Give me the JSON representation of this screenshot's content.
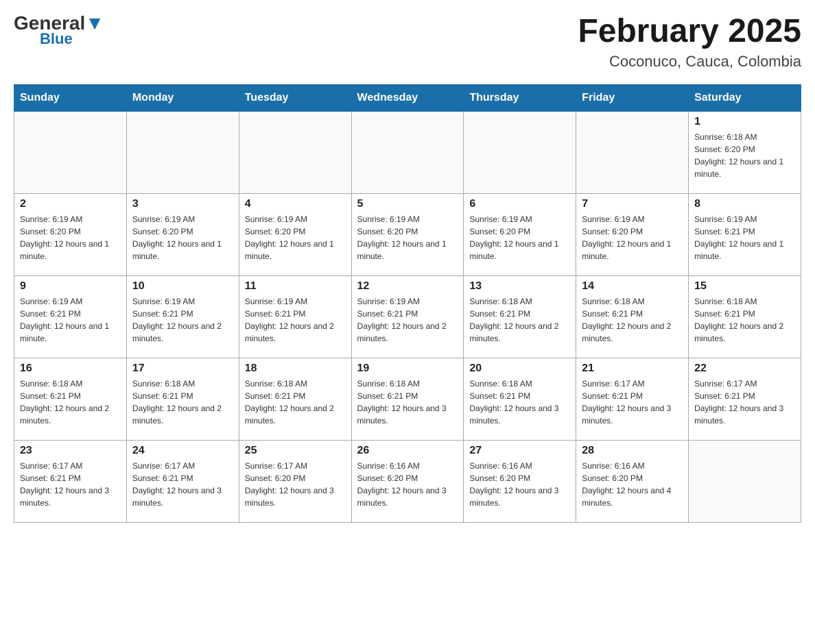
{
  "header": {
    "logo_general": "General",
    "logo_blue": "Blue",
    "month_title": "February 2025",
    "location": "Coconuco, Cauca, Colombia"
  },
  "days_of_week": [
    "Sunday",
    "Monday",
    "Tuesday",
    "Wednesday",
    "Thursday",
    "Friday",
    "Saturday"
  ],
  "weeks": [
    [
      {
        "day": "",
        "info": ""
      },
      {
        "day": "",
        "info": ""
      },
      {
        "day": "",
        "info": ""
      },
      {
        "day": "",
        "info": ""
      },
      {
        "day": "",
        "info": ""
      },
      {
        "day": "",
        "info": ""
      },
      {
        "day": "1",
        "info": "Sunrise: 6:18 AM\nSunset: 6:20 PM\nDaylight: 12 hours and 1 minute."
      }
    ],
    [
      {
        "day": "2",
        "info": "Sunrise: 6:19 AM\nSunset: 6:20 PM\nDaylight: 12 hours and 1 minute."
      },
      {
        "day": "3",
        "info": "Sunrise: 6:19 AM\nSunset: 6:20 PM\nDaylight: 12 hours and 1 minute."
      },
      {
        "day": "4",
        "info": "Sunrise: 6:19 AM\nSunset: 6:20 PM\nDaylight: 12 hours and 1 minute."
      },
      {
        "day": "5",
        "info": "Sunrise: 6:19 AM\nSunset: 6:20 PM\nDaylight: 12 hours and 1 minute."
      },
      {
        "day": "6",
        "info": "Sunrise: 6:19 AM\nSunset: 6:20 PM\nDaylight: 12 hours and 1 minute."
      },
      {
        "day": "7",
        "info": "Sunrise: 6:19 AM\nSunset: 6:20 PM\nDaylight: 12 hours and 1 minute."
      },
      {
        "day": "8",
        "info": "Sunrise: 6:19 AM\nSunset: 6:21 PM\nDaylight: 12 hours and 1 minute."
      }
    ],
    [
      {
        "day": "9",
        "info": "Sunrise: 6:19 AM\nSunset: 6:21 PM\nDaylight: 12 hours and 1 minute."
      },
      {
        "day": "10",
        "info": "Sunrise: 6:19 AM\nSunset: 6:21 PM\nDaylight: 12 hours and 2 minutes."
      },
      {
        "day": "11",
        "info": "Sunrise: 6:19 AM\nSunset: 6:21 PM\nDaylight: 12 hours and 2 minutes."
      },
      {
        "day": "12",
        "info": "Sunrise: 6:19 AM\nSunset: 6:21 PM\nDaylight: 12 hours and 2 minutes."
      },
      {
        "day": "13",
        "info": "Sunrise: 6:18 AM\nSunset: 6:21 PM\nDaylight: 12 hours and 2 minutes."
      },
      {
        "day": "14",
        "info": "Sunrise: 6:18 AM\nSunset: 6:21 PM\nDaylight: 12 hours and 2 minutes."
      },
      {
        "day": "15",
        "info": "Sunrise: 6:18 AM\nSunset: 6:21 PM\nDaylight: 12 hours and 2 minutes."
      }
    ],
    [
      {
        "day": "16",
        "info": "Sunrise: 6:18 AM\nSunset: 6:21 PM\nDaylight: 12 hours and 2 minutes."
      },
      {
        "day": "17",
        "info": "Sunrise: 6:18 AM\nSunset: 6:21 PM\nDaylight: 12 hours and 2 minutes."
      },
      {
        "day": "18",
        "info": "Sunrise: 6:18 AM\nSunset: 6:21 PM\nDaylight: 12 hours and 2 minutes."
      },
      {
        "day": "19",
        "info": "Sunrise: 6:18 AM\nSunset: 6:21 PM\nDaylight: 12 hours and 3 minutes."
      },
      {
        "day": "20",
        "info": "Sunrise: 6:18 AM\nSunset: 6:21 PM\nDaylight: 12 hours and 3 minutes."
      },
      {
        "day": "21",
        "info": "Sunrise: 6:17 AM\nSunset: 6:21 PM\nDaylight: 12 hours and 3 minutes."
      },
      {
        "day": "22",
        "info": "Sunrise: 6:17 AM\nSunset: 6:21 PM\nDaylight: 12 hours and 3 minutes."
      }
    ],
    [
      {
        "day": "23",
        "info": "Sunrise: 6:17 AM\nSunset: 6:21 PM\nDaylight: 12 hours and 3 minutes."
      },
      {
        "day": "24",
        "info": "Sunrise: 6:17 AM\nSunset: 6:21 PM\nDaylight: 12 hours and 3 minutes."
      },
      {
        "day": "25",
        "info": "Sunrise: 6:17 AM\nSunset: 6:20 PM\nDaylight: 12 hours and 3 minutes."
      },
      {
        "day": "26",
        "info": "Sunrise: 6:16 AM\nSunset: 6:20 PM\nDaylight: 12 hours and 3 minutes."
      },
      {
        "day": "27",
        "info": "Sunrise: 6:16 AM\nSunset: 6:20 PM\nDaylight: 12 hours and 3 minutes."
      },
      {
        "day": "28",
        "info": "Sunrise: 6:16 AM\nSunset: 6:20 PM\nDaylight: 12 hours and 4 minutes."
      },
      {
        "day": "",
        "info": ""
      }
    ]
  ]
}
